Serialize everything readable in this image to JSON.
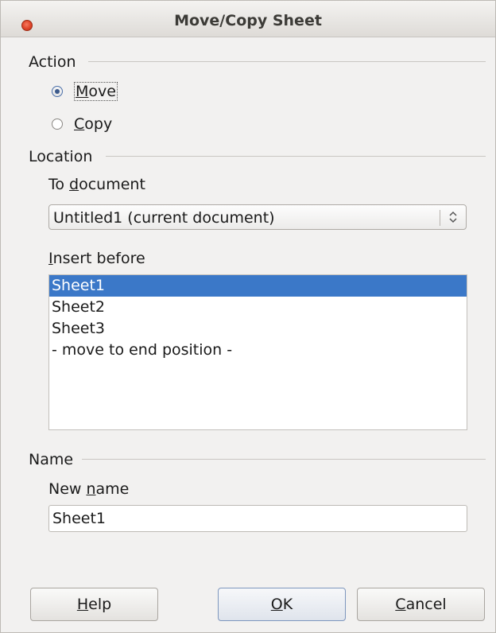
{
  "window": {
    "title": "Move/Copy Sheet"
  },
  "action": {
    "section_label": "Action",
    "options": [
      {
        "label": "Move",
        "checked": true
      },
      {
        "label": "Copy",
        "checked": false
      }
    ]
  },
  "location": {
    "section_label": "Location",
    "to_document": {
      "label_pre": "To ",
      "label_ul": "d",
      "label_post": "ocument",
      "value": "Untitled1 (current document)"
    },
    "insert_before": {
      "label_ul": "I",
      "label_post": "nsert before",
      "items": [
        {
          "label": "Sheet1",
          "selected": true
        },
        {
          "label": "Sheet2",
          "selected": false
        },
        {
          "label": "Sheet3",
          "selected": false
        },
        {
          "label": "- move to end position -",
          "selected": false
        }
      ]
    }
  },
  "name": {
    "section_label": "Name",
    "new_name": {
      "label_pre": "New ",
      "label_ul": "n",
      "label_post": "ame",
      "value": "Sheet1"
    }
  },
  "buttons": {
    "help": {
      "ul": "H",
      "rest": "elp"
    },
    "ok": {
      "ul": "O",
      "rest": "K"
    },
    "cancel": {
      "ul": "C",
      "rest": "ancel"
    }
  },
  "colors": {
    "selection": "#3b78c8",
    "close_button": "#e0442a"
  },
  "icons": {
    "close": "close-icon",
    "combo_arrows": "chevron-up-down-icon"
  }
}
